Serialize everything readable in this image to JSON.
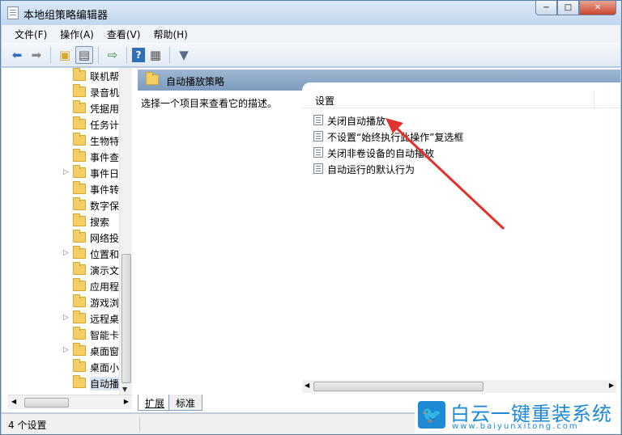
{
  "window": {
    "title": "本地组策略编辑器",
    "controls": [
      "−",
      "□",
      "✕"
    ]
  },
  "menu": [
    "文件(F)",
    "操作(A)",
    "查看(V)",
    "帮助(H)"
  ],
  "toolbar_icons": [
    "back-arrow-icon",
    "forward-arrow-icon",
    "up-folder-icon",
    "show-hide-tree-icon",
    "export-list-icon",
    "help-icon",
    "properties-icon",
    "filter-icon"
  ],
  "tree": {
    "items": [
      {
        "label": "联机帮",
        "expandable": false
      },
      {
        "label": "录音机",
        "expandable": false
      },
      {
        "label": "凭据用",
        "expandable": false
      },
      {
        "label": "任务计",
        "expandable": false
      },
      {
        "label": "生物特",
        "expandable": false
      },
      {
        "label": "事件查",
        "expandable": false
      },
      {
        "label": "事件日",
        "expandable": true
      },
      {
        "label": "事件转",
        "expandable": false
      },
      {
        "label": "数字保",
        "expandable": false
      },
      {
        "label": "搜索",
        "expandable": false
      },
      {
        "label": "网络投",
        "expandable": false
      },
      {
        "label": "位置和",
        "expandable": true
      },
      {
        "label": "演示文",
        "expandable": false
      },
      {
        "label": "应用程",
        "expandable": false
      },
      {
        "label": "游戏浏",
        "expandable": false
      },
      {
        "label": "远程桌",
        "expandable": true
      },
      {
        "label": "智能卡",
        "expandable": false
      },
      {
        "label": "桌面窗",
        "expandable": true
      },
      {
        "label": "桌面小",
        "expandable": false
      },
      {
        "label": "自动播",
        "expandable": false,
        "selected": true
      }
    ],
    "expander": "▷"
  },
  "detail": {
    "header": "自动播放策略",
    "description": "选择一个项目来查看它的描述。",
    "column": "设置",
    "settings": [
      "关闭自动播放",
      "不设置“始终执行此操作”复选框",
      "关闭非卷设备的自动播放",
      "自动运行的默认行为"
    ]
  },
  "tabs": [
    "扩展",
    "标准"
  ],
  "status": "4 个设置",
  "watermark": {
    "brand": "白云一键重装系统",
    "url": "www.baiyunxitong.com"
  },
  "annotation_color": "#e0322a"
}
